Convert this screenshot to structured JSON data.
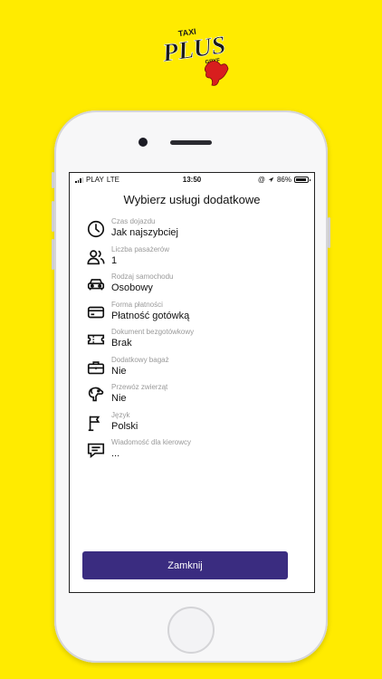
{
  "brand": {
    "logo_text": "TAXI PLUS GRYF"
  },
  "status_bar": {
    "carrier": "PLAY",
    "network": "LTE",
    "time": "13:50",
    "battery": "86%"
  },
  "screen": {
    "title": "Wybierz usługi dodatkowe",
    "options": [
      {
        "icon": "clock-icon",
        "label": "Czas dojazdu",
        "value": "Jak najszybciej"
      },
      {
        "icon": "passengers-icon",
        "label": "Liczba pasażerów",
        "value": "1"
      },
      {
        "icon": "car-icon",
        "label": "Rodzaj samochodu",
        "value": "Osobowy"
      },
      {
        "icon": "credit-card-icon",
        "label": "Forma płatności",
        "value": "Płatność gotówką"
      },
      {
        "icon": "ticket-icon",
        "label": "Dokument bezgotówkowy",
        "value": "Brak"
      },
      {
        "icon": "briefcase-icon",
        "label": "Dodatkowy bagaż",
        "value": "Nie"
      },
      {
        "icon": "dog-icon",
        "label": "Przewóz zwierząt",
        "value": "Nie"
      },
      {
        "icon": "flag-icon",
        "label": "Język",
        "value": "Polski"
      },
      {
        "icon": "message-icon",
        "label": "Wiadomość dla kierowcy",
        "value": "..."
      }
    ],
    "close_label": "Zamknij"
  },
  "colors": {
    "background": "#FFEB00",
    "button": "#3A2C80",
    "label_gray": "#9A9A9A"
  }
}
